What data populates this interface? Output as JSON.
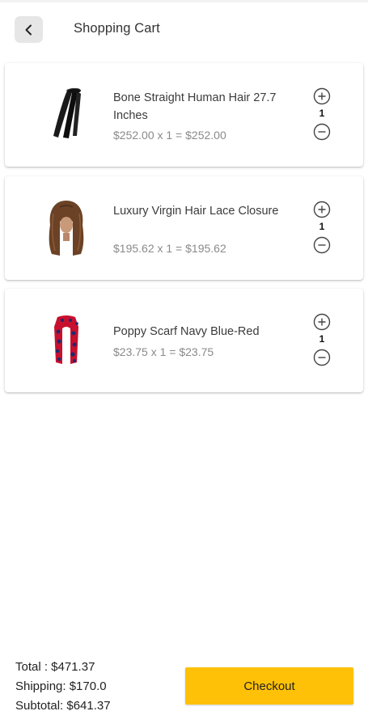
{
  "header": {
    "back_icon": "chevron-left-icon",
    "title": "Shopping Cart"
  },
  "cart": {
    "items": [
      {
        "name": "Bone Straight Human Hair 27.7 Inches",
        "price_line": "$252.00 x 1 = $252.00",
        "quantity": "1",
        "image": "straight-hair-bundle"
      },
      {
        "name": "Luxury Virgin Hair Lace Closure",
        "price_line": "$195.62 x 1 = $195.62",
        "quantity": "1",
        "image": "curly-wig"
      },
      {
        "name": "Poppy Scarf Navy Blue-Red",
        "price_line": "$23.75 x 1 = $23.75",
        "quantity": "1",
        "image": "navy-red-scarf"
      }
    ],
    "plus_icon": "plus-circle-icon",
    "minus_icon": "minus-circle-icon"
  },
  "summary": {
    "total": "Total : $471.37",
    "shipping": "Shipping: $170.0",
    "subtotal": "Subtotal: $641.37",
    "checkout_label": "Checkout"
  },
  "colors": {
    "checkout_button": "#ffc107",
    "back_button_bg": "#e6e6e6",
    "price_text": "#8a8a8a"
  }
}
